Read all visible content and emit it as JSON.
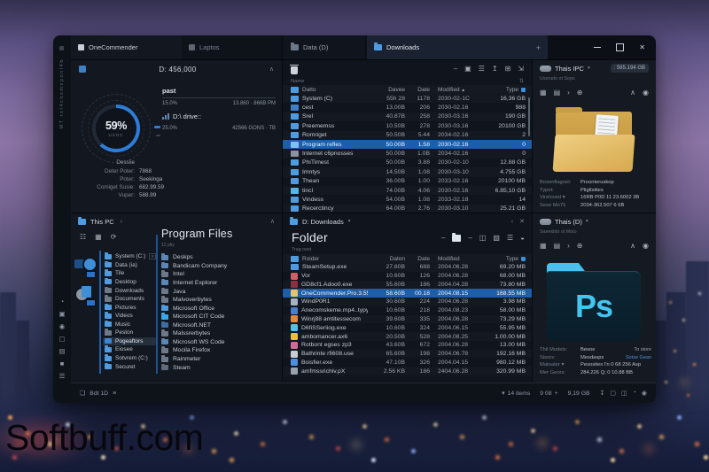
{
  "watermark": "Softbuff.com",
  "colors": {
    "accent": "#2d7dd8",
    "selection": "#1e5ea8",
    "folder_blue": "#4f9be0",
    "ps_cyan": "#43c5f0",
    "manila": "#d6a94e"
  },
  "win": {
    "strip": {
      "vertical_text": "MT rsl4cosmsponl4b",
      "icons": [
        {
          "name": "user-icon",
          "glyph": "◔"
        },
        {
          "name": "image-icon",
          "glyph": "▣"
        },
        {
          "name": "users-icon",
          "glyph": "◉"
        },
        {
          "name": "monitor-icon",
          "glyph": "▢"
        },
        {
          "name": "document-icon",
          "glyph": "▤"
        },
        {
          "name": "square-icon",
          "glyph": "■"
        },
        {
          "name": "server-icon",
          "glyph": "☰"
        }
      ]
    },
    "titlebar": {
      "tabs": [
        {
          "label": "OneCommender"
        },
        {
          "label": "Laptos"
        },
        {
          "label": "Data (D)"
        },
        {
          "label": "Downloads"
        }
      ],
      "new_tab": "+",
      "controls": {
        "close": "✕"
      }
    },
    "drive": {
      "header": "D: 456,000",
      "gauge": {
        "percent": "59%",
        "sub": "USOC"
      },
      "items": [
        {
          "name": "past",
          "percent": "15.0%",
          "value": "13.860 · 866B PM"
        },
        {
          "name": "D:\\ drive::",
          "percent": "25.0%",
          "value": "42566 GONS · TB",
          "bars": true
        }
      ],
      "stats_title": "Dessiie",
      "stats": [
        {
          "label": "Deter Poter:",
          "value": "7868"
        },
        {
          "label": "Poter:",
          "value": "Seekinga"
        },
        {
          "label": "Comiget Susie:",
          "value": "682.99.59"
        },
        {
          "label": "Vuper:",
          "value": "588.99"
        }
      ]
    },
    "toplist": {
      "toolbar": [
        {
          "name": "dash-icon",
          "glyph": "–"
        },
        {
          "name": "new-folder-icon",
          "glyph": "▣"
        },
        {
          "name": "list-view-icon",
          "glyph": "☰"
        },
        {
          "name": "upload-icon",
          "glyph": "↥"
        },
        {
          "name": "grid-view-icon",
          "glyph": "⊞"
        },
        {
          "name": "export-icon",
          "glyph": "⇲"
        }
      ],
      "name_label": "Name",
      "name_sort": "⇅",
      "header": {
        "name": "Datto",
        "size": "Davee",
        "count": "Date",
        "date": "Modified",
        "sort": "▲",
        "type": "Type"
      },
      "rows": [
        {
          "name": "System (C)",
          "icon": "#4f9be0",
          "size": "55h 28",
          "count": "1178",
          "date": "2030-02-1C",
          "type": "16,36 GB"
        },
        {
          "name": "cest",
          "icon": "#3f7fc4",
          "size": "13.00B",
          "count": "206",
          "date": "2030-02.16",
          "type": "988"
        },
        {
          "name": "Srel",
          "icon": "#4f9be0",
          "size": "40.87B",
          "count": "258",
          "date": "2030-03.16",
          "type": "190 GB"
        },
        {
          "name": "Preememss",
          "icon": "#4f9be0",
          "size": "10.50B",
          "count": "278",
          "date": "2030-03.16",
          "type": "20100 GB"
        },
        {
          "name": "Romriget",
          "icon": "#4f9be0",
          "size": "50.50B",
          "count": "5.44",
          "date": "2034-02.16",
          "type": "2"
        },
        {
          "name": "Program refles",
          "icon": "#7fc0f2",
          "selected": true,
          "size": "50.00B",
          "count": "1.58",
          "date": "2030-02.16",
          "type": "0"
        },
        {
          "name": "Internet c6pnosses",
          "icon": "#8b93a0",
          "size": "50.00B",
          "count": "1.0B",
          "date": "2034-02.16",
          "type": "0"
        },
        {
          "name": "PhiTimest",
          "icon": "#4f9be0",
          "size": "50.00B",
          "count": "3.88",
          "date": "2030-02-10",
          "type": "12.88 GB"
        },
        {
          "name": "Imntys",
          "icon": "#4f9be0",
          "size": "14.50B",
          "count": "1.08",
          "date": "2030-03-10",
          "type": "4.755 GB"
        },
        {
          "name": "Thean",
          "icon": "#4f9be0",
          "size": "36.00B",
          "count": "1.00",
          "date": "2033-02.16",
          "type": "20100 MB"
        },
        {
          "name": "tincl",
          "icon": "#56b7e6",
          "size": "74.00B",
          "count": "4.06",
          "date": "2030-02.16",
          "type": "6.85,10 GB"
        },
        {
          "name": "Vindess",
          "icon": "#4f9be0",
          "size": "54.00B",
          "count": "1.08",
          "date": "2033-02.18",
          "type": "14"
        },
        {
          "name": "Recerctincy",
          "icon": "#4f9be0",
          "size": "64.00B",
          "count": "2.76",
          "date": "2030-03.10",
          "type": "25.21 GB"
        }
      ]
    },
    "toppreview": {
      "title": "Thais IPC",
      "caret": "▾",
      "size": ": 565.194 GB",
      "subtitle": "Userado ot Sopo",
      "toolbar_left": [
        {
          "name": "grid-view-icon",
          "glyph": "▦"
        },
        {
          "name": "panel-icon",
          "glyph": "▤"
        },
        {
          "name": "chevron-right-icon",
          "glyph": "›"
        },
        {
          "name": "globe-icon",
          "glyph": "⊕"
        }
      ],
      "toolbar_right": [
        {
          "name": "collapse-icon",
          "glyph": "∧"
        },
        {
          "name": "camera-icon",
          "glyph": "◉"
        }
      ],
      "props": [
        {
          "label": "Boxenflagnet:",
          "value": "Proonteruskop"
        },
        {
          "label": "Typet:",
          "value": "Pligtlsities"
        },
        {
          "label": "Vireloved ▾",
          "value": "16RB P0D 11 23.6002 3B"
        },
        {
          "label": "Sese Mo75",
          "value": "2034-362.507 6 6B"
        }
      ]
    },
    "thispc": {
      "tab": "This PC",
      "chev": "›",
      "collapse": "∧",
      "close": "✕",
      "toolbar": [
        {
          "name": "list-view-icon",
          "glyph": "☷"
        },
        {
          "name": "grid-view-icon",
          "glyph": "▦"
        },
        {
          "name": "refresh-icon",
          "glyph": "⟳"
        }
      ],
      "tree": [
        {
          "label": "System (C:)",
          "icon": "#4f9be0",
          "close": true
        },
        {
          "label": "Data (ia)",
          "icon": "#4f9be0"
        },
        {
          "label": "Tile",
          "icon": "#4f9be0"
        },
        {
          "label": "Desktop",
          "icon": "#4f9be0"
        },
        {
          "label": "Downloads",
          "icon": "#6d7889"
        },
        {
          "label": "Documents",
          "icon": "#6d7889"
        },
        {
          "label": "Pictures",
          "icon": "#4f9be0"
        },
        {
          "label": "Videos",
          "icon": "#4f9be0"
        },
        {
          "label": "Music",
          "icon": "#4f9be0"
        },
        {
          "label": "Peston",
          "icon": "#6d7889"
        },
        {
          "label": "Pogeaftors",
          "icon": "#3b86d8",
          "selected": true,
          "shape": "square"
        },
        {
          "label": "Eiosee",
          "icon": "#4f9be0"
        },
        {
          "label": "Sotvrem (C:)",
          "icon": "#4f9be0"
        },
        {
          "label": "Securet",
          "icon": "#4f9be0"
        }
      ],
      "folder_title": "Program Files",
      "folder_subtitle": "11 pliy",
      "folders": [
        {
          "label": "Deskps",
          "icon": "#5a87b8"
        },
        {
          "label": "Bandicam Company",
          "icon": "#5a87b8"
        },
        {
          "label": "Intel",
          "icon": "#6d7889"
        },
        {
          "label": "Internet Explorer",
          "icon": "#5a87b8"
        },
        {
          "label": "Java",
          "icon": "#6d7889"
        },
        {
          "label": "Malvoverbytes",
          "icon": "#6d7889"
        },
        {
          "label": "Microsoft Office",
          "icon": "#4f9be0"
        },
        {
          "label": "Microsoft CIT Code",
          "icon": "#38a8e8"
        },
        {
          "label": "Microsoft.NET",
          "icon": "#3a6ea5"
        },
        {
          "label": "Malssrerbytes",
          "icon": "#6d7889"
        },
        {
          "label": "Microsoft WS Code",
          "icon": "#5a87b8"
        },
        {
          "label": "Mocila Firefox",
          "icon": "#6d7889"
        },
        {
          "label": "Rainmeter",
          "icon": "#6d7889"
        },
        {
          "label": "Steam",
          "icon": "#5f6a7a"
        }
      ]
    },
    "botlist": {
      "tab": "D: Downloads",
      "caret": "▾",
      "back": "‹",
      "close": "✕",
      "title": "Folder",
      "subtitle": "Trag oost",
      "toolbar": [
        {
          "name": "dash-icon",
          "glyph": "–"
        },
        {
          "name": "pause-icon",
          "glyph": "◫"
        },
        {
          "name": "pattern-icon",
          "glyph": "▨"
        },
        {
          "name": "list-view-icon",
          "glyph": "☰"
        },
        {
          "name": "more-icon",
          "glyph": "◒"
        }
      ],
      "header": {
        "name": "Roider",
        "size": "Daton",
        "count": "Date",
        "date": "Modified",
        "type": "Type"
      },
      "rows": [
        {
          "name": "SteamSetup.exe",
          "icon": "#4f9be0",
          "shape": "folder",
          "size": "27.60B",
          "count": "688",
          "date": "2004.06.28",
          "type": "69.20 MB"
        },
        {
          "name": "Vor",
          "icon": "#cf5f66",
          "shape": "file",
          "size": "10.60B",
          "count": "126",
          "date": "2004.06.28",
          "type": "68.00 MB"
        },
        {
          "name": "GD8cf1.Adoo0.exe",
          "icon": "#8a3040",
          "shape": "file",
          "size": "55.60B",
          "count": "186",
          "date": "2004.04.28",
          "type": "73.80 MB"
        },
        {
          "name": "OneCommender.Pro.3.55.4.zip",
          "icon": "#e8c468",
          "shape": "file",
          "selected": true,
          "size": "58.60B",
          "count": "00.18",
          "date": "2004.08.15",
          "type": "168.55 MB"
        },
        {
          "name": "WindP0R1",
          "icon": "#aab2bd",
          "shape": "file",
          "size": "30.60B",
          "count": "224",
          "date": "2004.06.28",
          "type": "3.98 MB"
        },
        {
          "name": "Anecomskeme.mp4..typy!",
          "icon": "#4a7fd0",
          "shape": "file",
          "size": "10.60B",
          "count": "218",
          "date": "2004.08.23",
          "type": "58.00 MB"
        },
        {
          "name": "Winrj88 amtitessecom",
          "icon": "#e0873a",
          "shape": "file",
          "size": "39.60B",
          "count": "335",
          "date": "2004.06.28",
          "type": "73.29 MB"
        },
        {
          "name": "D6fiSSeriiog.exe",
          "icon": "#58c0d8",
          "shape": "file",
          "size": "10.60B",
          "count": "324",
          "date": "2004.06.15",
          "type": "55.95 MB"
        },
        {
          "name": "ambomancer.ax6",
          "icon": "#e8c040",
          "shape": "file",
          "size": "20.50B",
          "count": "528",
          "date": "2004.08.25",
          "type": "1.00.00 MB"
        },
        {
          "name": "Rotbont egses zp3",
          "icon": "#d06a9a",
          "shape": "file",
          "size": "43.60B",
          "count": "672",
          "date": "2004.06.28",
          "type": "13.00 MB"
        },
        {
          "name": "Bathrinte rfi608.use",
          "icon": "#c8cdd4",
          "shape": "file",
          "size": "65.60B",
          "count": "198",
          "date": "2004.06.78",
          "type": "192.16 MB"
        },
        {
          "name": "Boisfier.exe",
          "icon": "#4a90e0",
          "shape": "file",
          "size": "47.10B",
          "count": "326",
          "date": "2004.04.15",
          "type": "980.12 MB"
        },
        {
          "name": "amfmssrichiv.pX",
          "icon": "#9aa2ae",
          "shape": "file",
          "size": "2.56 KB",
          "count": "186",
          "date": "2404.06.28",
          "type": "320.99 MB"
        }
      ]
    },
    "botpreview": {
      "title": "Thais (D)",
      "caret": "▾",
      "subtitle": "Saeeiddo ot Moto",
      "toolbar_left": [
        {
          "name": "grid-view-icon",
          "glyph": "▦"
        },
        {
          "name": "panel-icon",
          "glyph": "▤"
        },
        {
          "name": "chevron-right-icon",
          "glyph": "›"
        },
        {
          "name": "globe-icon",
          "glyph": "⊕"
        }
      ],
      "toolbar_right": [
        {
          "name": "collapse-icon",
          "glyph": "∧"
        },
        {
          "name": "camera-icon",
          "glyph": "◉"
        }
      ],
      "ps_label": "Ps",
      "link_top": "To store",
      "link": "Sotse Gean",
      "props": [
        {
          "label": "Thil Models:",
          "value": "Besoe"
        },
        {
          "label": "Sisors:",
          "value": "Mesdasps"
        },
        {
          "label": "Matoater ▾",
          "value": "Pesosites I'n 0 68 256 Asp"
        },
        {
          "label": "Mer Geors:",
          "value": "284.226 Q; 0 10.88 BB"
        }
      ]
    },
    "statusbar": {
      "left_icon": "❏",
      "left_label": "Bdt 1D",
      "left_eq": "≡",
      "items_caret": "▾",
      "items": "14 items",
      "mid": "9 08",
      "plus": "+",
      "size": "9,19 GB",
      "icons": [
        {
          "name": "download-icon",
          "glyph": "↧"
        },
        {
          "name": "monitor-icon",
          "glyph": "▢"
        },
        {
          "name": "columns-icon",
          "glyph": "◫"
        },
        {
          "name": "user-icon",
          "glyph": "◔"
        },
        {
          "name": "camera-icon",
          "glyph": "◉"
        }
      ]
    }
  }
}
